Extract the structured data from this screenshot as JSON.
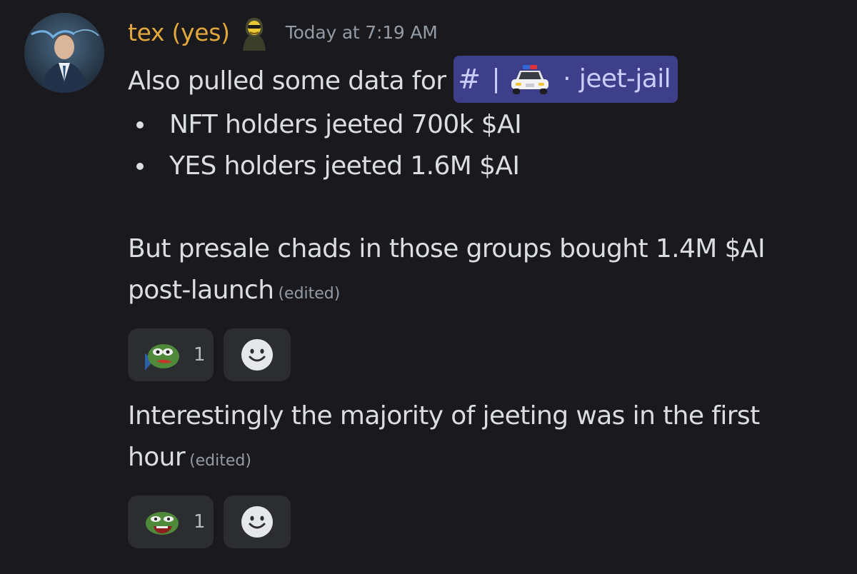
{
  "message": {
    "username": "tex (yes)",
    "timestamp": "Today at 7:19 AM",
    "line1_prefix": "Also pulled some data for ",
    "channel_mention": {
      "hash": "#",
      "separator": "|",
      "dot": "·",
      "name": "jeet-jail"
    },
    "bullets": [
      "NFT holders jeeted 700k $AI",
      "YES holders jeeted 1.6M $AI"
    ],
    "paragraph_line1": "But presale chads in those groups bought 1.4M $AI",
    "paragraph_line2": "post-launch",
    "edited_label": "(edited)"
  },
  "reactions_1": {
    "count": "1"
  },
  "message2": {
    "line1": "Interestingly the majority of jeeting was in the first",
    "line2": "hour",
    "edited_label": "(edited)"
  },
  "reactions_2": {
    "count": "1"
  },
  "colors": {
    "background": "#1a1a1e",
    "username": "#e3a83b",
    "mention_bg": "#3d3f8a",
    "reaction_bg": "#2b2d31"
  }
}
